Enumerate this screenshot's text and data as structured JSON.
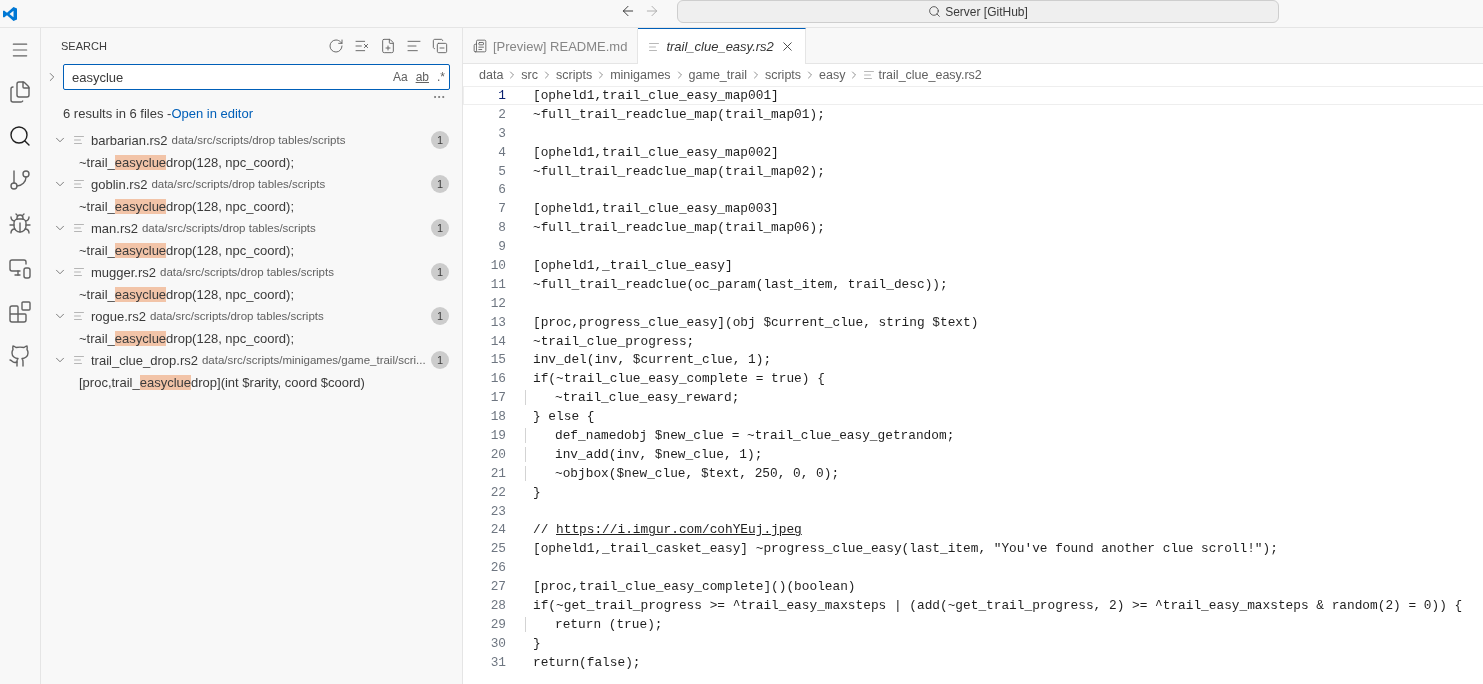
{
  "title_bar": {
    "command_center": "Server [GitHub]"
  },
  "sidebar": {
    "title": "SEARCH",
    "query": "easyclue",
    "options": [
      "Aa",
      "ab",
      ".*"
    ],
    "summary": "6 results in 6 files - ",
    "summary_link": "Open in editor",
    "results": [
      {
        "file": "barbarian.rs2",
        "path": "data/src/scripts/drop tables/scripts",
        "count": "1",
        "expanded": true,
        "match": {
          "before": "~trail_",
          "highlight": "easyclue",
          "after": "drop(128, npc_coord);"
        }
      },
      {
        "file": "goblin.rs2",
        "path": "data/src/scripts/drop tables/scripts",
        "count": "1",
        "expanded": true,
        "match": {
          "before": "~trail_",
          "highlight": "easyclue",
          "after": "drop(128, npc_coord);"
        }
      },
      {
        "file": "man.rs2",
        "path": "data/src/scripts/drop tables/scripts",
        "count": "1",
        "expanded": true,
        "match": {
          "before": "~trail_",
          "highlight": "easyclue",
          "after": "drop(128, npc_coord);"
        }
      },
      {
        "file": "mugger.rs2",
        "path": "data/src/scripts/drop tables/scripts",
        "count": "1",
        "expanded": true,
        "match": {
          "before": "~trail_",
          "highlight": "easyclue",
          "after": "drop(128, npc_coord);"
        }
      },
      {
        "file": "rogue.rs2",
        "path": "data/src/scripts/drop tables/scripts",
        "count": "1",
        "expanded": true,
        "match": {
          "before": "~trail_",
          "highlight": "easyclue",
          "after": "drop(128, npc_coord);"
        }
      },
      {
        "file": "trail_clue_drop.rs2",
        "path": "data/src/scripts/minigames/game_trail/scri...",
        "count": "1",
        "expanded": true,
        "match": {
          "before": "[proc,trail_",
          "highlight": "easyclue",
          "after": "drop](int $rarity, coord $coord)"
        }
      }
    ]
  },
  "tabs": [
    {
      "label": "[Preview] README.md",
      "kind": "preview",
      "selected": false
    },
    {
      "label": "trail_clue_easy.rs2",
      "kind": "file",
      "selected": true
    }
  ],
  "breadcrumb": [
    "data",
    "src",
    "scripts",
    "minigames",
    "game_trail",
    "scripts",
    "easy",
    "trail_clue_easy.rs2"
  ],
  "code": [
    {
      "number": "1",
      "text": "[opheld1,trail_clue_easy_map001]",
      "indented": false,
      "current": true
    },
    {
      "number": "2",
      "text": "~full_trail_readclue_map(trail_map01);",
      "indented": false,
      "current": false
    },
    {
      "number": "3",
      "current": false
    },
    {
      "number": "4",
      "text": "[opheld1,trail_clue_easy_map002]",
      "indented": false,
      "current": false
    },
    {
      "number": "5",
      "text": "~full_trail_readclue_map(trail_map02);",
      "indented": false,
      "current": false
    },
    {
      "number": "6",
      "current": false
    },
    {
      "number": "7",
      "text": "[opheld1,trail_clue_easy_map003]",
      "indented": false,
      "current": false
    },
    {
      "number": "8",
      "text": "~full_trail_readclue_map(trail_map06);",
      "indented": false,
      "current": false
    },
    {
      "number": "9",
      "current": false
    },
    {
      "number": "10",
      "text": "[opheld1,_trail_clue_easy]",
      "indented": false,
      "current": false
    },
    {
      "number": "11",
      "text": "~full_trail_readclue(oc_param(last_item, trail_desc));",
      "indented": false,
      "current": false
    },
    {
      "number": "12",
      "current": false
    },
    {
      "number": "13",
      "text": "[proc,progress_clue_easy](obj $current_clue, string $text)",
      "indented": false,
      "current": false
    },
    {
      "number": "14",
      "text": "~trail_clue_progress;",
      "indented": false,
      "current": false
    },
    {
      "number": "15",
      "text": "inv_del(inv, $current_clue, 1);",
      "indented": false,
      "current": false
    },
    {
      "number": "16",
      "text": "if(~trail_clue_easy_complete = true) {",
      "indented": false,
      "current": false
    },
    {
      "number": "17",
      "text": "~trail_clue_easy_reward;",
      "indented": true,
      "current": false
    },
    {
      "number": "18",
      "text": "} else {",
      "indented": false,
      "current": false
    },
    {
      "number": "19",
      "text": "def_namedobj $new_clue = ~trail_clue_easy_getrandom;",
      "indented": true,
      "current": false
    },
    {
      "number": "20",
      "text": "inv_add(inv, $new_clue, 1);",
      "indented": true,
      "current": false
    },
    {
      "number": "21",
      "text": "~objbox($new_clue, $text, 250, 0, 0);",
      "indented": true,
      "current": false
    },
    {
      "number": "22",
      "text": "}",
      "indented": false,
      "current": false
    },
    {
      "number": "23",
      "current": false
    },
    {
      "number": "24",
      "text": "// ",
      "link": "https://i.imgur.com/cohYEuj.jpeg",
      "indented": false,
      "current": false
    },
    {
      "number": "25",
      "text": "[opheld1,_trail_casket_easy] ~progress_clue_easy(last_item, \"You've found another clue scroll!\");",
      "indented": false,
      "current": false
    },
    {
      "number": "26",
      "current": false
    },
    {
      "number": "27",
      "text": "[proc,trail_clue_easy_complete]()(boolean)",
      "indented": false,
      "current": false
    },
    {
      "number": "28",
      "text": "if(~get_trail_progress >= ^trail_easy_maxsteps | (add(~get_trail_progress, 2) >= ^trail_easy_maxsteps & random(2) = 0)) {",
      "indented": false,
      "current": false
    },
    {
      "number": "29",
      "text": "return (true);",
      "indented": true,
      "current": false
    },
    {
      "number": "30",
      "text": "}",
      "indented": false,
      "current": false
    },
    {
      "number": "31",
      "text": "return(false);",
      "indented": false,
      "current": false
    }
  ]
}
